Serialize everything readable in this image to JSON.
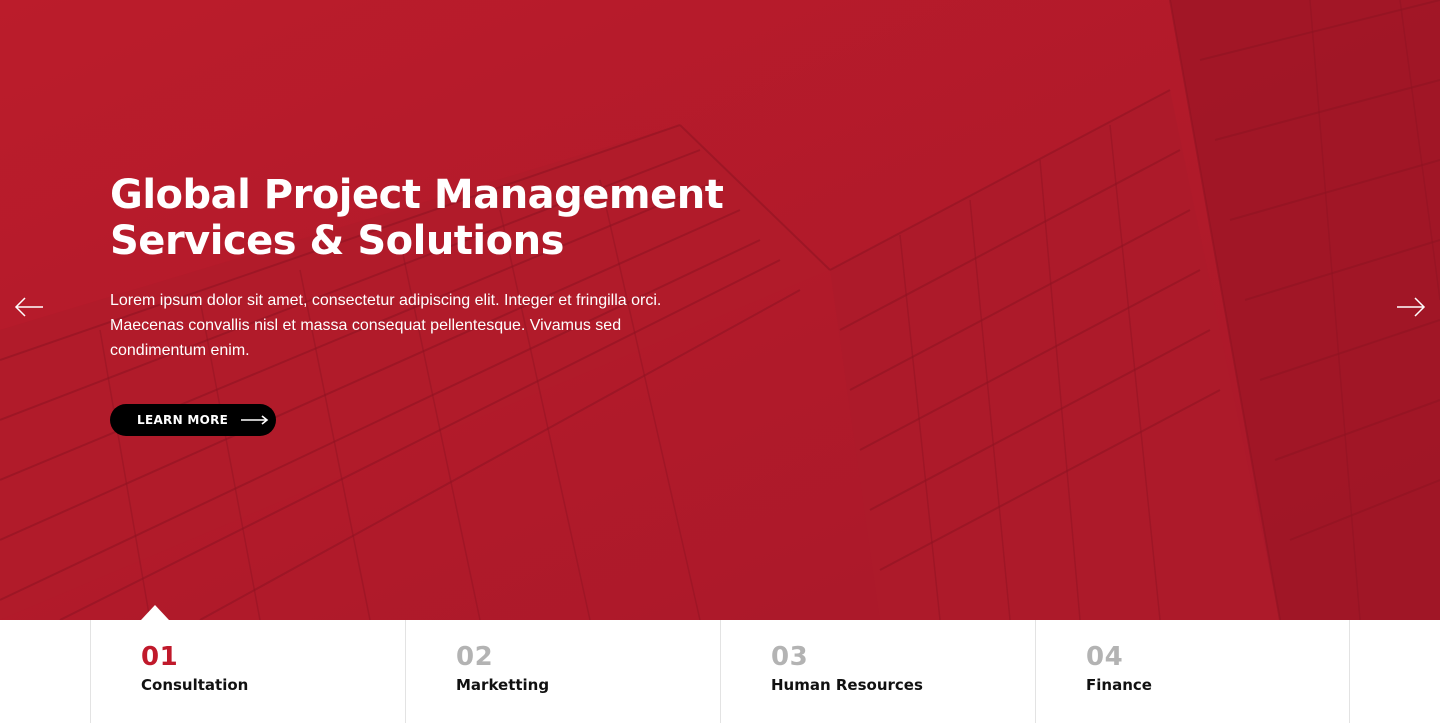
{
  "hero": {
    "title_line1": "Global Project Management",
    "title_line2": "Services & Solutions",
    "description": "Lorem ipsum dolor sit amet, consectetur adipiscing elit. Integer et fringilla orci. Maecenas convallis nisl et massa consequat pellentesque. Vivamus sed condimentum enim.",
    "button_label": "LEARN MORE",
    "background_color": "#b71c2a",
    "prev_icon": "arrow-left-icon",
    "next_icon": "arrow-right-icon"
  },
  "tabs": [
    {
      "number": "01",
      "label": "Consultation",
      "active": true
    },
    {
      "number": "02",
      "label": "Marketting",
      "active": false
    },
    {
      "number": "03",
      "label": "Human Resources",
      "active": false
    },
    {
      "number": "04",
      "label": "Finance",
      "active": false
    }
  ],
  "colors": {
    "accent": "#c0192b",
    "inactive_number": "#b3b3b3",
    "button_bg": "#000000"
  }
}
